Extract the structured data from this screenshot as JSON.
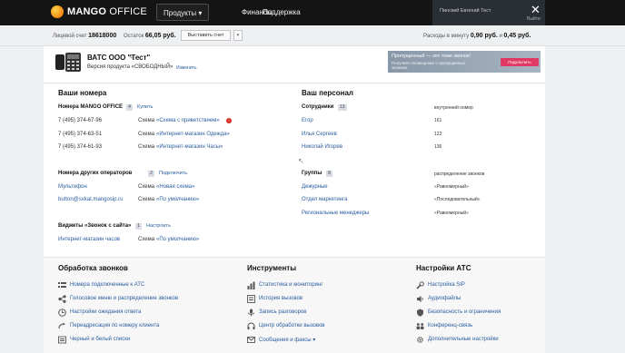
{
  "topbar": {
    "logo_bold": "MANGO",
    "logo_rest": " OFFICE",
    "nav": {
      "products": "Продукты ▾",
      "finance": "Финансы",
      "support": "Поддержка"
    },
    "user_name": "Пинский Евгений Тест",
    "close": "✕",
    "logout": "Выйти"
  },
  "account": {
    "acct_label": "Лицевой счет",
    "acct_value": "18618000",
    "balance_label": "Остаток",
    "balance_value": "66,05 руб.",
    "invoice_button": "Выставить счет",
    "invoice_arrow": "▾",
    "expenses_label": "Расходы в минуту",
    "expenses_value": "0,90 руб.",
    "and": "и",
    "expenses_value2": "0,45 руб."
  },
  "header": {
    "title": "ВАТС ООО \"Тест\"",
    "edit": "✎",
    "version": "Версия продукта «СВОБОДНЫЙ»",
    "version_change": "Изменить",
    "promo_line1": "Пропущенный — это тоже звонок!",
    "promo_line2": "Получите оповещение о пропущенных звонках!",
    "promo_button": "Подключить"
  },
  "numbers": {
    "heading": "Ваши номера",
    "mango_label": "Номера MANGO OFFICE",
    "mango_count": "4",
    "buy_link": "Купить",
    "rows": [
      {
        "number": "7 (495) 374-67-96",
        "scheme_label": "Схема",
        "scheme": "«Схема с приветствием»",
        "alert": "!"
      },
      {
        "number": "7 (495) 374-63-51",
        "scheme_label": "Схема",
        "scheme": "«Интернет-магазин Одежда»"
      },
      {
        "number": "7 (495) 374-61-93",
        "scheme_label": "Схема",
        "scheme": "«Интернет-магазин Часы»"
      }
    ],
    "other_label": "Номера других операторов",
    "other_count": "2",
    "connect_link": "Подключить",
    "other_rows": [
      {
        "number": "Мультифон",
        "scheme_label": "Схема",
        "scheme": "«Новая схема»"
      },
      {
        "number": "button@sxkat.mangosip.ru",
        "scheme_label": "Схема",
        "scheme": "«По умолчанию»"
      }
    ],
    "widget_label": "Виджеты «Звонок с сайта»",
    "widget_count": "1",
    "setup_link": "Настроить",
    "widget_rows": [
      {
        "number": "Интернет-магазин часов",
        "scheme_label": "Схема",
        "scheme": "«По умолчанию»"
      }
    ]
  },
  "staff": {
    "heading": "Ваш персонал",
    "employees_label": "Сотрудники",
    "employees_count": "13",
    "internal_number": "внутренний номер",
    "employees": [
      {
        "name": "Егор",
        "ext": "161"
      },
      {
        "name": "Илья Сергеев",
        "ext": "122"
      },
      {
        "name": "Николай Игорев",
        "ext": "136"
      }
    ],
    "groups_label": "Группы",
    "groups_count": "8",
    "call_distribution": "распределение звонков",
    "groups": [
      {
        "name": "Дежурные",
        "dist": "«Равномерный»"
      },
      {
        "name": "Отдел маркетинга",
        "dist": "«Последовательный»"
      },
      {
        "name": "Региональные менеджеры",
        "dist": "«Равномерный»"
      }
    ]
  },
  "bottom": {
    "col1_title": "Обработка звонков",
    "col1_items": [
      "Номера подключенные к АТС",
      "Голосовое меню и распределение звонков",
      "Настройки ожидания ответа",
      "Переадресация по номеру клиента",
      "Черный и белый списки"
    ],
    "col2_title": "Инструменты",
    "col2_items": [
      "Статистика и мониторинг",
      "История вызовов",
      "Запись разговоров",
      "Центр обработки вызовов",
      "Сообщения и факсы ▾"
    ],
    "col3_title": "Настройки АТС",
    "col3_items": [
      "Настройка SIP",
      "Аудиофайлы",
      "Безопасность и ограничения",
      "Конференц-связь",
      "Дополнительные настройки"
    ]
  },
  "colors": {
    "accent": "#2a5d9f",
    "topbar": "#141414",
    "promo_button": "#e03a64",
    "alert": "#d42a1e"
  },
  "icons": [
    "mango-logo-icon",
    "pbx-phone-icon",
    "pencil-icon",
    "close-icon",
    "cursor-icon",
    "list-icon",
    "share-icon",
    "clock-icon",
    "redirect-icon",
    "phone-list-icon",
    "chart-icon",
    "history-icon",
    "microphone-icon",
    "headset-icon",
    "envelope-icon",
    "wrench-icon",
    "audio-icon",
    "shield-icon",
    "conference-icon",
    "gear-icon"
  ]
}
